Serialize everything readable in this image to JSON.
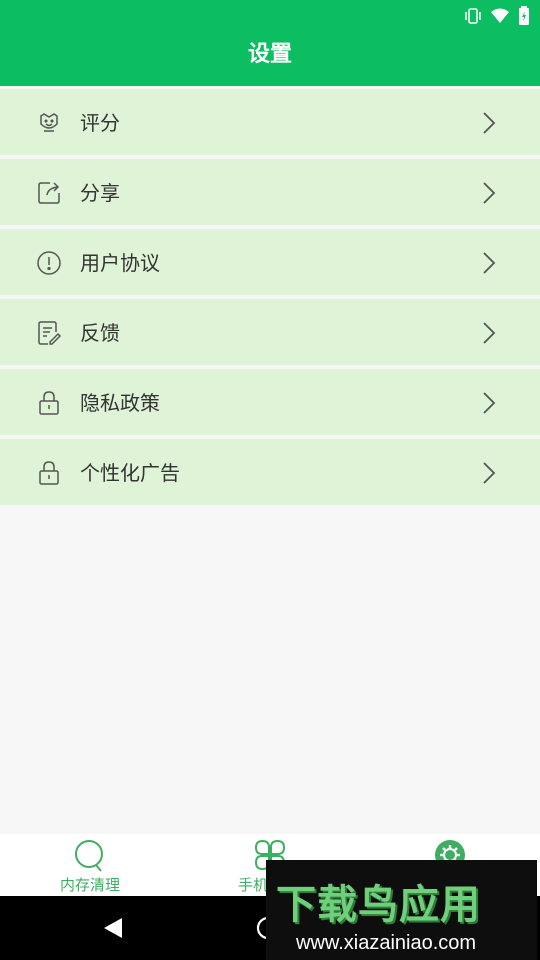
{
  "header": {
    "title": "设置"
  },
  "status_bar": {
    "icons": [
      "vibrate-icon",
      "wifi-icon",
      "battery-icon"
    ]
  },
  "settings": {
    "items": [
      {
        "label": "评分",
        "icon": "rate-icon"
      },
      {
        "label": "分享",
        "icon": "share-icon"
      },
      {
        "label": "用户协议",
        "icon": "info-icon"
      },
      {
        "label": "反馈",
        "icon": "feedback-icon"
      },
      {
        "label": "隐私政策",
        "icon": "lock-icon"
      },
      {
        "label": "个性化广告",
        "icon": "lock-icon"
      }
    ]
  },
  "bottom_nav": {
    "items": [
      {
        "label": "内存清理",
        "icon": "search-circle-icon"
      },
      {
        "label": "手机",
        "icon": "clover-icon"
      },
      {
        "label": "",
        "icon": "gear-icon"
      }
    ]
  },
  "watermark": {
    "logo": "下载鸟应用",
    "url": "www.xiazainiao.com"
  },
  "colors": {
    "header_bg": "#0cbd62",
    "item_bg": "#dff3d7",
    "nav_accent": "#3fae62",
    "page_bg": "#f7f7f7"
  }
}
